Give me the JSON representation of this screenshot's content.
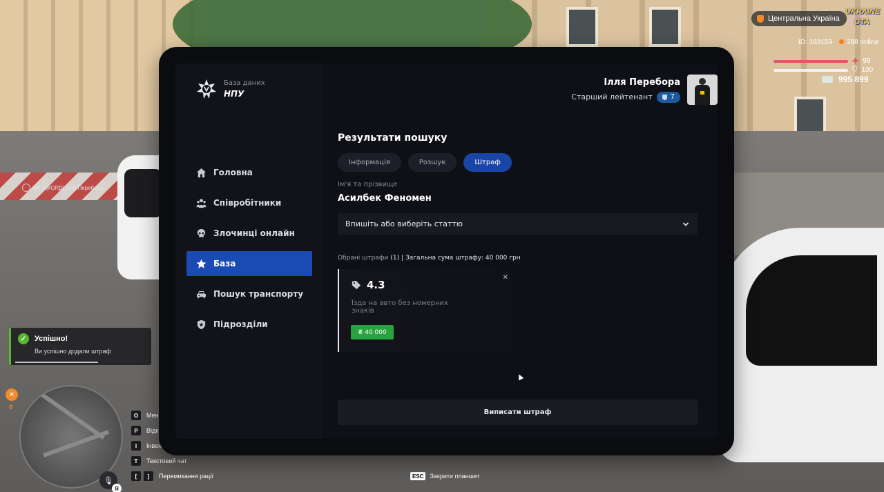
{
  "hud": {
    "region": "Центральна Україна",
    "game_logo_line1": "UKRAINE",
    "game_logo_line2": "GTA",
    "player_id": "ID: 163159",
    "online": "288 online",
    "health": "99",
    "health_level": 0.99,
    "armor": "100",
    "armor_level": 1.0,
    "money": "995 899",
    "nametag": "[НПУ|КОРД] Ілля Перебора",
    "hunger_value": "0",
    "voice_lang": "Я",
    "esc_key": "ESC",
    "esc_label": "Закрити планшет",
    "keys": [
      {
        "key": "O",
        "label": "Мен"
      },
      {
        "key": "P",
        "label": "Відк"
      },
      {
        "key": "I",
        "label": "Інвент"
      },
      {
        "key": "T",
        "label": "Текстовий чат"
      }
    ],
    "radio_keys": [
      "[",
      "]"
    ],
    "radio_label": "Перемикання рації"
  },
  "toast": {
    "title": "Успішно!",
    "message": "Ви успішно додали штраф"
  },
  "brand": {
    "subtitle": "База даних",
    "title": "НПУ"
  },
  "nav": {
    "items": [
      {
        "label": "Головна",
        "icon": "home-icon"
      },
      {
        "label": "Співробітники",
        "icon": "users-icon"
      },
      {
        "label": "Злочинці онлайн",
        "icon": "skull-icon"
      },
      {
        "label": "База",
        "icon": "star-icon"
      },
      {
        "label": "Пошук транспорту",
        "icon": "car-icon"
      },
      {
        "label": "Підрозділи",
        "icon": "shield-icon"
      }
    ],
    "active_index": 3
  },
  "user": {
    "name": "Ілля Перебора",
    "rank": "Старший лейтенант",
    "level": "7"
  },
  "search": {
    "title": "Результати пошуку",
    "tabs": [
      "Інформація",
      "Розшук",
      "Штраф"
    ],
    "active_tab": 2,
    "name_label": "Ім'я та прізвище",
    "person_name": "Асилбек Феномен",
    "article_placeholder": "Впишіть або виберіть статтю"
  },
  "fines": {
    "summary_label": "Обрані штрафи",
    "summary_count": "(1)",
    "summary_total": "| Загальна сума штрафу: 40 000 грн",
    "items": [
      {
        "code": "4.3",
        "description": "Їзда на авто без номерних знаків",
        "currency": "₴",
        "amount": "40 000"
      }
    ],
    "submit_label": "Виписати штраф"
  },
  "colors": {
    "accent": "#1a4bb5",
    "tab_active": "#1a45a8",
    "success": "#29a340",
    "panel": "#0e1015"
  }
}
